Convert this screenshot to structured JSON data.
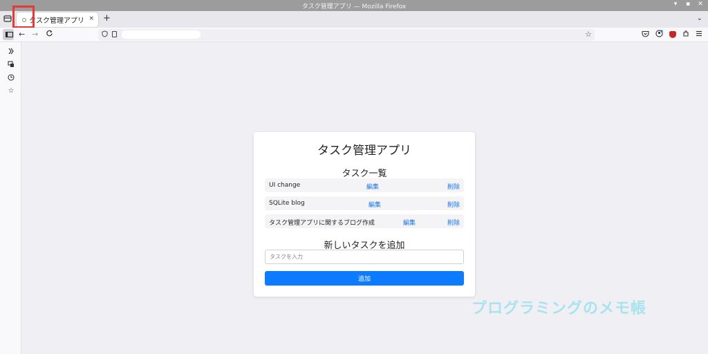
{
  "window": {
    "title": "タスク管理アプリ — Mozilla Firefox",
    "controls": [
      "▾",
      "▪",
      "✕"
    ]
  },
  "tabs": [
    {
      "label": "タスク管理アプリ",
      "close": "×"
    }
  ],
  "tabstrip": {
    "new_tab": "+",
    "list_menu": "⌄"
  },
  "navbar": {
    "back": "←",
    "forward": "→",
    "reload": "C",
    "url": "",
    "icons": [
      "shield-icon",
      "page-icon",
      "bookmark-star-icon",
      "pocket-icon",
      "account-icon",
      "ublock-icon",
      "extensions-icon",
      "menu-icon"
    ]
  },
  "sidebar": {
    "icons": [
      "ai-chatbot-icon",
      "synced-tabs-icon",
      "history-icon",
      "bookmarks-icon"
    ]
  },
  "app": {
    "title": "タスク管理アプリ",
    "list_title": "タスク一覧",
    "tasks": [
      {
        "name": "UI change",
        "edit": "編集",
        "delete": "削除"
      },
      {
        "name": "SQLite blog",
        "edit": "編集",
        "delete": "削除"
      },
      {
        "name": "タスク管理アプリに関するブログ作成",
        "edit": "編集",
        "delete": "削除"
      }
    ],
    "add_title": "新しいタスクを追加",
    "input_placeholder": "タスクを入力",
    "input_value": "",
    "add_button": "追加"
  },
  "watermark": "プログラミングのメモ帳",
  "colors": {
    "accent": "#0d7bff",
    "link": "#1a73e8",
    "highlight": "#e53935",
    "watermark": "#a8e3ee"
  }
}
